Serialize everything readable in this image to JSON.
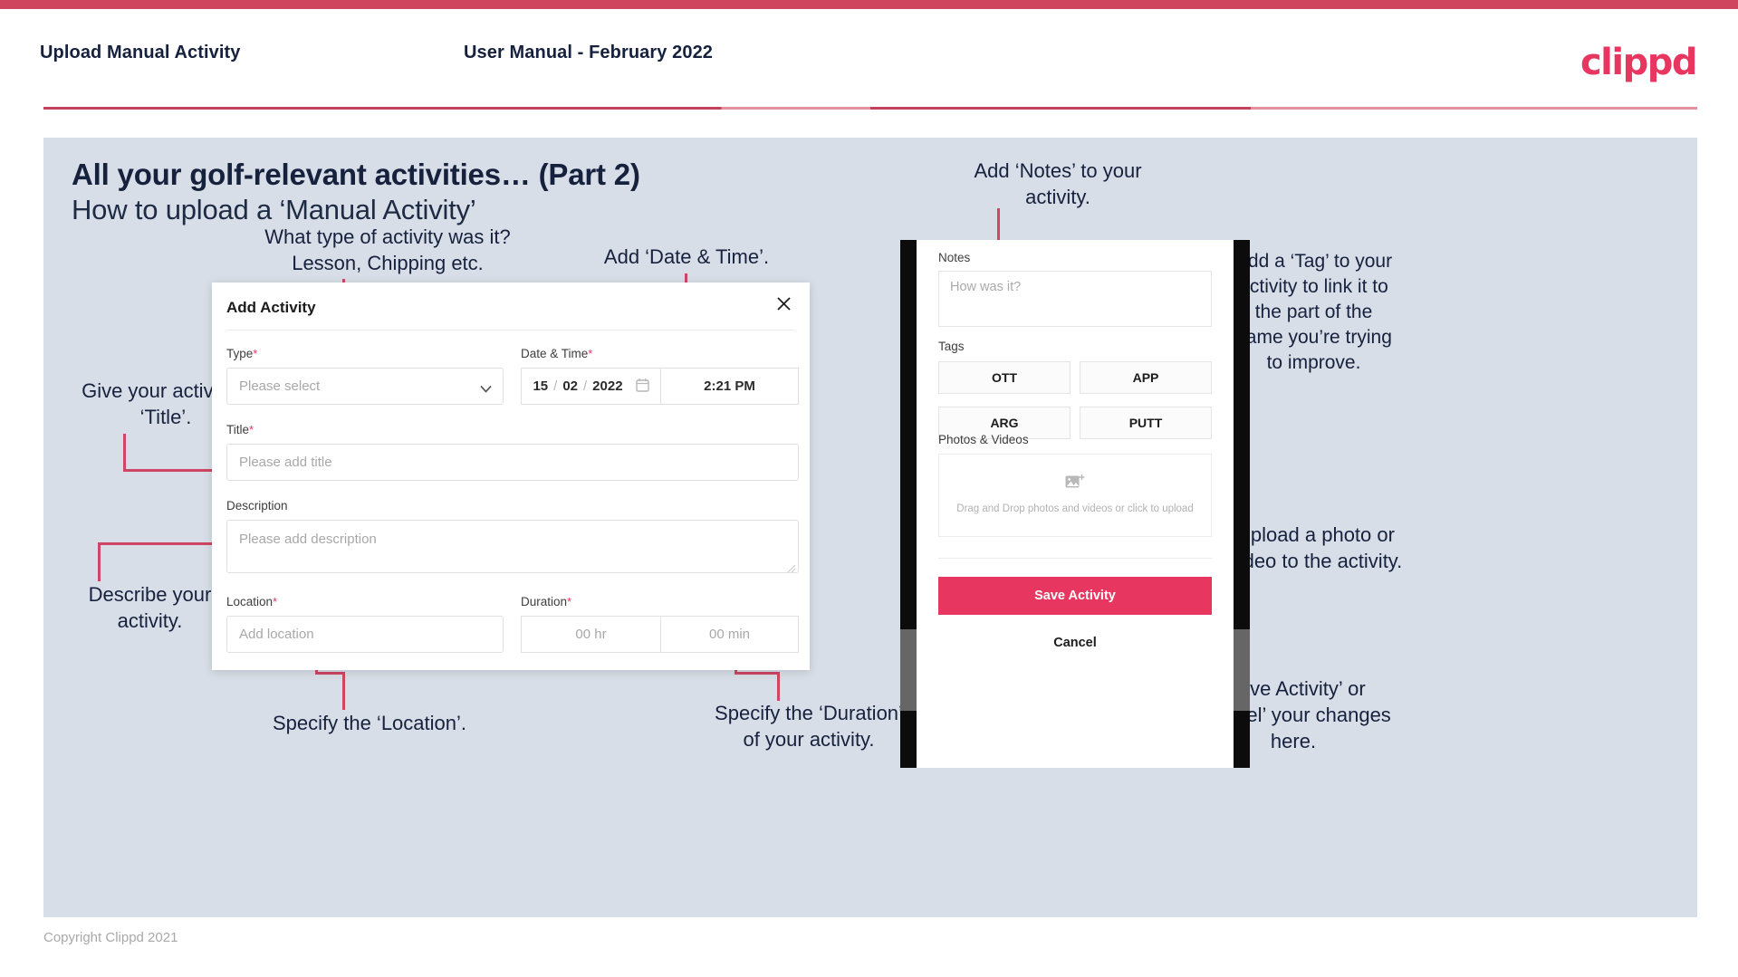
{
  "header": {
    "left_title": "Upload Manual Activity",
    "center_title": "User Manual - February 2022",
    "logo": "clippd"
  },
  "slide": {
    "title": "All your golf-relevant activities… (Part 2)",
    "subtitle": "How to upload a ‘Manual Activity’"
  },
  "dialog": {
    "title": "Add Activity",
    "close_icon": "close-icon",
    "fields": {
      "type": {
        "label": "Type",
        "required": "*",
        "placeholder": "Please select"
      },
      "datetime": {
        "label": "Date & Time",
        "required": "*",
        "day": "15",
        "month": "02",
        "year": "2022",
        "sep": "/",
        "calendar_icon": "calendar-icon",
        "time": "2:21 PM"
      },
      "title": {
        "label": "Title",
        "required": "*",
        "placeholder": "Please add title"
      },
      "description": {
        "label": "Description",
        "placeholder": "Please add description"
      },
      "location": {
        "label": "Location",
        "required": "*",
        "placeholder": "Add location"
      },
      "duration": {
        "label": "Duration",
        "required": "*",
        "hours": "00 hr",
        "minutes": "00 min"
      }
    }
  },
  "phone": {
    "notes": {
      "label": "Notes",
      "placeholder": "How was it?"
    },
    "tags": {
      "label": "Tags",
      "items": [
        "OTT",
        "APP",
        "ARG",
        "PUTT"
      ]
    },
    "photos": {
      "label": "Photos & Videos",
      "icon": "add-image-icon",
      "drop_text": "Drag and Drop photos and videos or\nclick to upload"
    },
    "save_label": "Save Activity",
    "cancel_label": "Cancel"
  },
  "annotations": {
    "type": "What type of activity was it?\nLesson, Chipping etc.",
    "datetime": "Add ‘Date & Time’.",
    "title": "Give your activity a\n‘Title’.",
    "description": "Describe your\nactivity.",
    "location": "Specify the ‘Location’.",
    "duration": "Specify the ‘Duration’\nof your activity.",
    "notes": "Add ‘Notes’ to your\nactivity.",
    "tags": "Add a ‘Tag’ to your\nactivity to link it to\nthe part of the\ngame you’re trying\nto improve.",
    "photos": "Upload a photo or\nvideo to the activity.",
    "save_cancel": "‘Save Activity’ or\n‘Cancel’ your changes\nhere."
  },
  "footer": {
    "copyright": "Copyright Clippd 2021"
  },
  "colors": {
    "brand": "#e7365f",
    "accent_bar": "#cf445f",
    "annotation_line": "#cf4664",
    "slide_bg": "#d8dee7",
    "text_dark": "#16213e"
  }
}
